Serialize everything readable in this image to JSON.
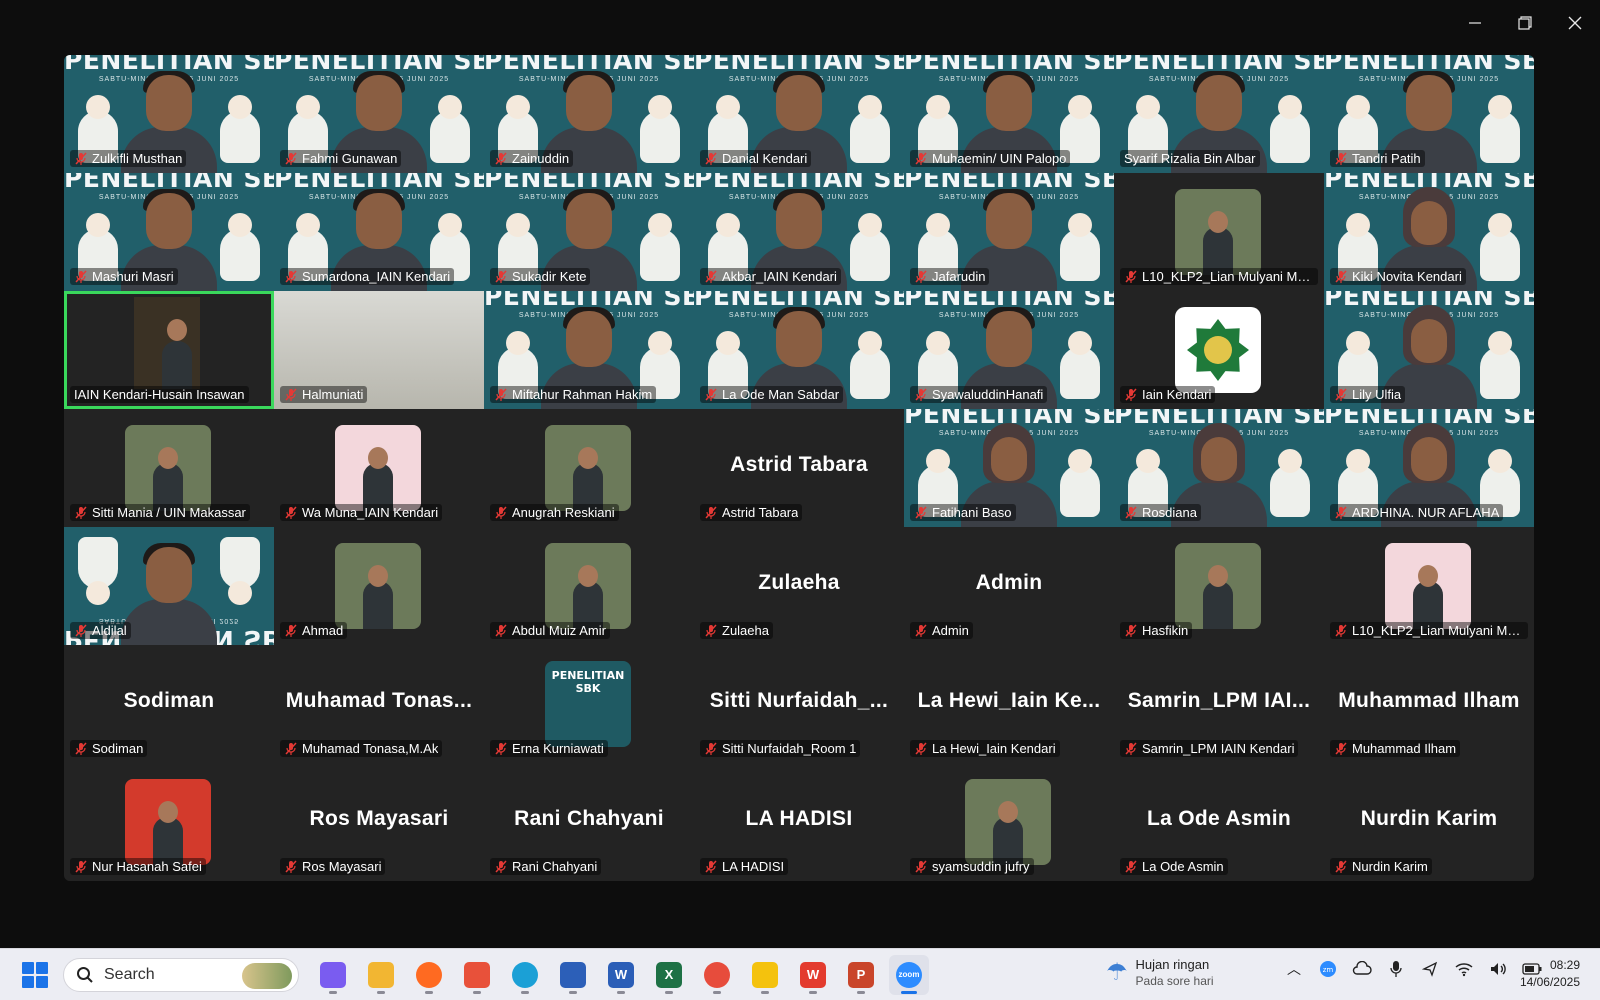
{
  "window": {
    "minimize_label": "Minimize",
    "restore_label": "Restore",
    "close_label": "Close"
  },
  "banner": {
    "title": "PENELITIAN SBK",
    "subtitle": "SABTU-MINGGU, 14-15 JUNI 2025",
    "logo_text": "PENELITIAN SBK"
  },
  "participants": [
    {
      "name": "Zulkifli Musthan",
      "kind": "banner-video",
      "muted": true
    },
    {
      "name": "Fahmi Gunawan",
      "kind": "banner-video",
      "muted": true
    },
    {
      "name": "Zainuddin",
      "kind": "banner-video",
      "muted": true
    },
    {
      "name": "Danial Kendari",
      "kind": "banner-video",
      "muted": true
    },
    {
      "name": "Muhaemin/ UIN Palopo",
      "kind": "banner-video",
      "muted": true
    },
    {
      "name": "Syarif Rizalia Bin Albar",
      "kind": "banner-video",
      "muted": false
    },
    {
      "name": "Tandri Patih",
      "kind": "banner-video",
      "muted": true
    },
    {
      "name": "Mashuri Masri",
      "kind": "banner-video",
      "muted": true
    },
    {
      "name": "Sumardona_IAIN Kendari",
      "kind": "banner-video",
      "muted": true
    },
    {
      "name": "Sukadir Kete",
      "kind": "banner-video",
      "muted": true
    },
    {
      "name": "Akbar_IAIN Kendari",
      "kind": "banner-video",
      "muted": true
    },
    {
      "name": "Jafarudin",
      "kind": "banner-video",
      "muted": true
    },
    {
      "name": "L10_KLP2_Lian Mulyani Muth...",
      "kind": "photo",
      "muted": true
    },
    {
      "name": "Kiki Novita Kendari",
      "kind": "banner-video-hijab",
      "muted": true
    },
    {
      "name": "IAIN Kendari-Husain Insawan",
      "kind": "photo-dark",
      "muted": false,
      "speaking": true
    },
    {
      "name": "Halmuniati",
      "kind": "gray",
      "muted": true
    },
    {
      "name": "Miftahur Rahman Hakim",
      "kind": "banner-video",
      "muted": true
    },
    {
      "name": "La Ode Man Sabdar",
      "kind": "banner-video",
      "muted": true
    },
    {
      "name": "SyawaluddinHanafi",
      "kind": "banner-video",
      "muted": true
    },
    {
      "name": "Iain Kendari",
      "kind": "logo",
      "muted": true
    },
    {
      "name": "Lily Ulfia",
      "kind": "banner-video-hijab",
      "muted": true
    },
    {
      "name": "Sitti Mania / UIN Makassar",
      "kind": "photo",
      "muted": true
    },
    {
      "name": "Wa  Muna_IAIN Kendari",
      "kind": "photo-hijab",
      "muted": true
    },
    {
      "name": "Anugrah Reskiani",
      "kind": "photo",
      "muted": true
    },
    {
      "name": "Astrid Tabara",
      "kind": "name",
      "display": "Astrid Tabara",
      "muted": true
    },
    {
      "name": "Fatihani Baso",
      "kind": "banner-video-hijab",
      "muted": true
    },
    {
      "name": "Rosdiana",
      "kind": "banner-video-hijab",
      "muted": true
    },
    {
      "name": "ARDHINA. NUR AFLAHA",
      "kind": "banner-video-hijab",
      "muted": true
    },
    {
      "name": "Aldilal",
      "kind": "banner-flip",
      "muted": true
    },
    {
      "name": "Ahmad",
      "kind": "photo",
      "muted": true
    },
    {
      "name": "Abdul Muiz Amir",
      "kind": "photo",
      "muted": true
    },
    {
      "name": "Zulaeha",
      "kind": "name",
      "display": "Zulaeha",
      "muted": true
    },
    {
      "name": "Admin",
      "kind": "name",
      "display": "Admin",
      "muted": true
    },
    {
      "name": "Hasfikin",
      "kind": "photo",
      "muted": true
    },
    {
      "name": "L10_KLP2_Lian Mulyani Muth...",
      "kind": "photo-hijab",
      "muted": true
    },
    {
      "name": "Sodiman",
      "kind": "name",
      "display": "Sodiman",
      "muted": true
    },
    {
      "name": "Muhamad Tonasa,M.Ak",
      "kind": "name",
      "display": "Muhamad  Tonas...",
      "muted": true
    },
    {
      "name": "Erna Kurniawati",
      "kind": "poster",
      "muted": true
    },
    {
      "name": "Sitti Nurfaidah_Room 1",
      "kind": "name",
      "display": "Sitti  Nurfaidah_...",
      "muted": true
    },
    {
      "name": "La Hewi_Iain Kendari",
      "kind": "name",
      "display": "La  Hewi_Iain  Ke...",
      "muted": true
    },
    {
      "name": "Samrin_LPM IAIN Kendari",
      "kind": "name",
      "display": "Samrin_LPM  IAI...",
      "muted": true
    },
    {
      "name": "Muhammad Ilham",
      "kind": "name",
      "display": "Muhammad Ilham",
      "muted": true
    },
    {
      "name": "Nur Hasanah Safei",
      "kind": "photo-hijab-red",
      "muted": true
    },
    {
      "name": "Ros Mayasari",
      "kind": "name",
      "display": "Ros Mayasari",
      "muted": true
    },
    {
      "name": "Rani Chahyani",
      "kind": "name",
      "display": "Rani Chahyani",
      "muted": true
    },
    {
      "name": "LA HADISI",
      "kind": "name",
      "display": "LA HADISI",
      "muted": true
    },
    {
      "name": "syamsuddin jufry",
      "kind": "photo",
      "muted": true
    },
    {
      "name": "La Ode Asmin",
      "kind": "name",
      "display": "La Ode Asmin",
      "muted": true
    },
    {
      "name": "Nurdin Karim",
      "kind": "name",
      "display": "Nurdin Karim",
      "muted": true
    }
  ],
  "taskbar": {
    "search_placeholder": "Search",
    "apps": [
      {
        "name": "copilot",
        "icon": "copilot-icon",
        "color": "#7a5cf0",
        "glyph": "",
        "active": false
      },
      {
        "name": "file-explorer",
        "icon": "folder-icon",
        "color": "#f2b632",
        "glyph": "",
        "active": false
      },
      {
        "name": "firefox",
        "icon": "firefox-icon",
        "color": "#ff6a21",
        "glyph": "",
        "active": false
      },
      {
        "name": "power-app",
        "icon": "power-icon",
        "color": "#e8513a",
        "glyph": "",
        "active": false
      },
      {
        "name": "edge",
        "icon": "edge-icon",
        "color": "#1ba0d6",
        "glyph": "",
        "active": false
      },
      {
        "name": "store-app",
        "icon": "store-icon",
        "color": "#2c5fb8",
        "glyph": "",
        "active": false
      },
      {
        "name": "word",
        "icon": "word-icon",
        "color": "#2b5eb7",
        "glyph": "W",
        "active": false
      },
      {
        "name": "excel",
        "icon": "excel-icon",
        "color": "#1e7145",
        "glyph": "X",
        "active": false
      },
      {
        "name": "chrome",
        "icon": "chrome-icon",
        "color": "#e74c3c",
        "glyph": "",
        "active": false
      },
      {
        "name": "google-drive",
        "icon": "drive-icon",
        "color": "#f4c20d",
        "glyph": "",
        "active": false
      },
      {
        "name": "wps-office",
        "icon": "wps-icon",
        "color": "#e33b2e",
        "glyph": "W",
        "active": false
      },
      {
        "name": "powerpoint",
        "icon": "powerpoint-icon",
        "color": "#c9452a",
        "glyph": "P",
        "active": false
      },
      {
        "name": "zoom",
        "icon": "zoom-icon",
        "color": "#2d8cff",
        "glyph": "zoom",
        "active": true
      }
    ],
    "weather": {
      "condition": "Hujan ringan",
      "detail": "Pada sore hari"
    },
    "time": "08:29",
    "date": "14/06/2025"
  },
  "colors": {
    "speaking_border": "#3ad85c",
    "muted_icon": "#e53935",
    "banner_bg": "#215f6a",
    "tile_bg": "#232323"
  }
}
